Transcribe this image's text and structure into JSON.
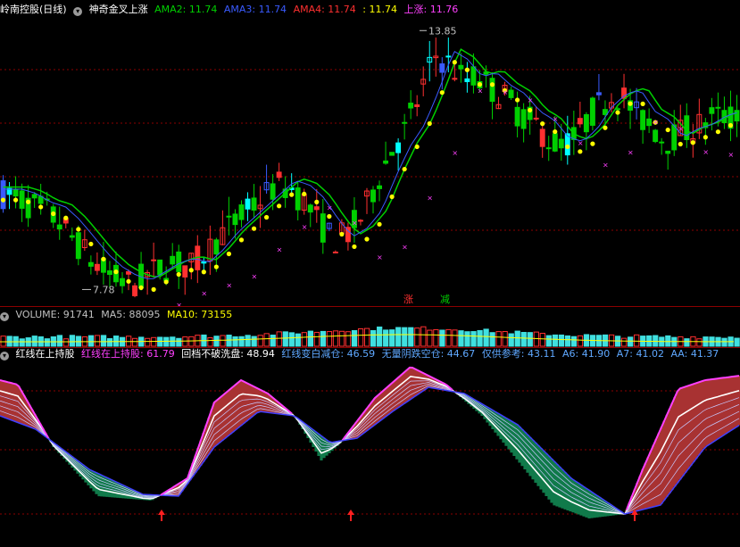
{
  "main_panel": {
    "title": "岭南控股(日线)",
    "indicator": "神奇金叉上涨",
    "legend": [
      {
        "label": "AMA2: 11.74",
        "color": "#00d000"
      },
      {
        "label": "AMA3: 11.74",
        "color": "#3a5bff"
      },
      {
        "label": "AMA4: 11.74",
        "color": "#ff3030"
      },
      {
        "label": ": 11.74",
        "color": "#ffff00"
      },
      {
        "label": "上涨: 11.76",
        "color": "#ff40ff"
      }
    ],
    "high_label": "13.85",
    "low_label": "7.78",
    "signal_up": "涨",
    "signal_down": "减"
  },
  "volume_panel": {
    "title": "VOLUME: 91741",
    "ma5": "MA5: 88095",
    "ma10": "MA10: 73155"
  },
  "sub_panel": {
    "title": "红线在上持股",
    "legend": [
      {
        "label": "红线在上持股: 61.79",
        "color": "#ff40ff"
      },
      {
        "label": "回档不破洗盘: 48.94",
        "color": "#ffffff"
      },
      {
        "label": "红线变白减仓: 46.59",
        "color": "#5fa8ff"
      },
      {
        "label": "无量阴跌空仓: 44.67",
        "color": "#5fa8ff"
      },
      {
        "label": "仅供参考: 43.11",
        "color": "#5fa8ff"
      },
      {
        "label": "A6: 41.90",
        "color": "#5fa8ff"
      },
      {
        "label": "A7: 41.02",
        "color": "#5fa8ff"
      },
      {
        "label": "AA: 41.37",
        "color": "#5fa8ff"
      }
    ]
  },
  "chart_data": [
    {
      "type": "candlestick",
      "title": "岭南控股(日线)",
      "y_range": [
        7.5,
        14.0
      ],
      "annotations": {
        "high": 13.85,
        "low": 7.78
      },
      "series": [
        {
          "name": "AMA2",
          "value": 11.74
        },
        {
          "name": "AMA3",
          "value": 11.74
        },
        {
          "name": "AMA4",
          "value": 11.74
        },
        {
          "name": "上涨",
          "value": 11.76
        }
      ],
      "close_trend_approx": [
        10.0,
        9.9,
        9.7,
        9.6,
        9.3,
        8.9,
        8.5,
        8.2,
        8.0,
        7.9,
        8.1,
        8.3,
        8.4,
        8.3,
        8.6,
        9.0,
        9.3,
        9.6,
        9.9,
        10.2,
        10.1,
        9.8,
        9.3,
        8.9,
        9.1,
        9.5,
        10.3,
        11.0,
        11.5,
        12.3,
        13.2,
        13.0,
        12.6,
        12.7,
        12.4,
        12.2,
        11.8,
        11.6,
        11.2,
        11.1,
        11.4,
        11.9,
        12.2,
        12.3,
        11.8,
        11.6,
        11.2,
        11.4,
        11.5,
        11.7,
        11.8,
        11.7
      ]
    },
    {
      "type": "bar",
      "title": "VOLUME",
      "series": [
        {
          "name": "VOLUME",
          "value": 91741
        },
        {
          "name": "MA5",
          "value": 88095
        },
        {
          "name": "MA10",
          "value": 73155
        }
      ]
    },
    {
      "type": "line",
      "title": "红线在上持股",
      "series": [
        {
          "name": "红线在上持股",
          "value": 61.79
        },
        {
          "name": "回档不破洗盘",
          "value": 48.94
        },
        {
          "name": "红线变白减仓",
          "value": 46.59
        },
        {
          "name": "无量阴跌空仓",
          "value": 44.67
        },
        {
          "name": "仅供参考",
          "value": 43.11
        },
        {
          "name": "A6",
          "value": 41.9
        },
        {
          "name": "A7",
          "value": 41.02
        },
        {
          "name": "AA",
          "value": 41.37
        }
      ]
    }
  ]
}
